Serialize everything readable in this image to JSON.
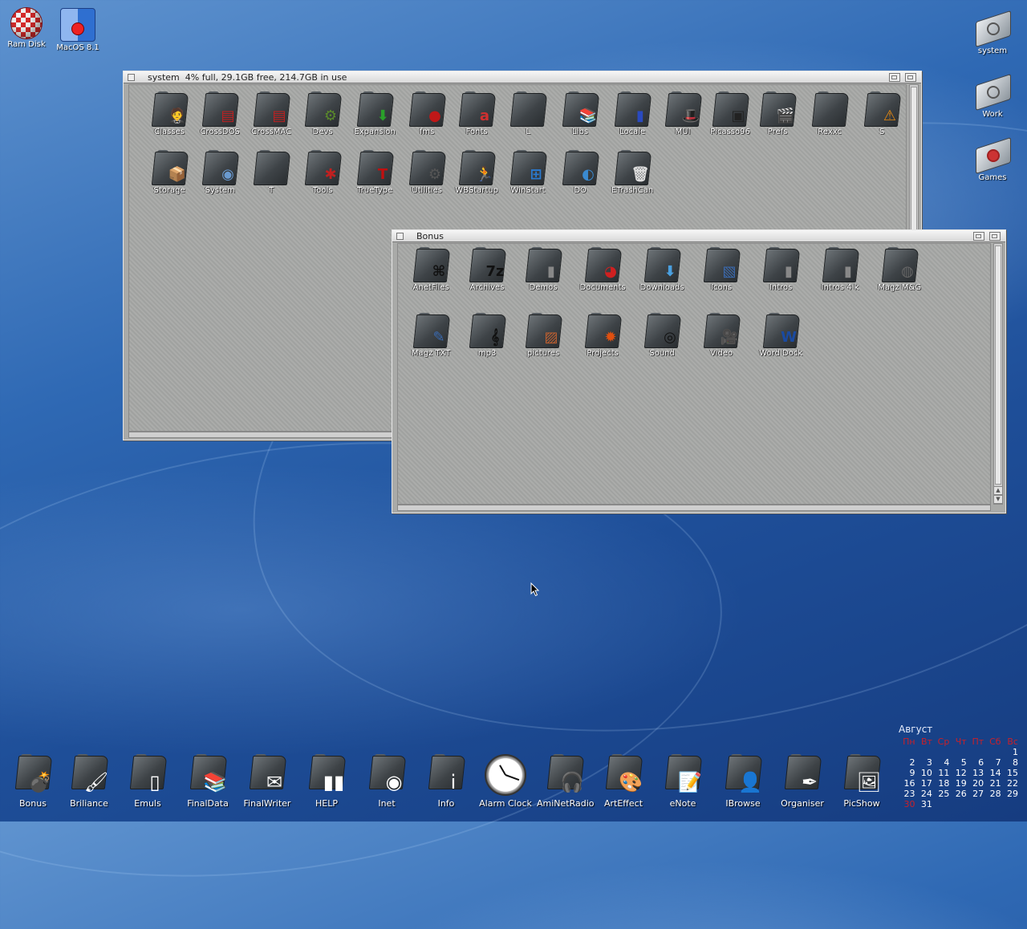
{
  "desktop": {
    "left_icons": [
      {
        "label": "Ram Disk",
        "icon": "boing-ball-icon"
      },
      {
        "label": "MacOS 8.1",
        "icon": "finder-icon"
      }
    ],
    "right_icons": [
      {
        "label": "system",
        "icon": "drive-icon"
      },
      {
        "label": "Work",
        "icon": "drive-icon"
      },
      {
        "label": "Games",
        "icon": "drive-joystick-icon"
      }
    ]
  },
  "system_window": {
    "title": "system  4% full, 29.1GB free, 214.7GB in use",
    "items": [
      {
        "label": "Classes",
        "glyph": "🤵",
        "color": "#222"
      },
      {
        "label": "CrossDOS",
        "glyph": "▤",
        "color": "#c02020"
      },
      {
        "label": "CrossMAC",
        "glyph": "▤",
        "color": "#c02020"
      },
      {
        "label": "Devs",
        "glyph": "⚙",
        "color": "#5a8a2a"
      },
      {
        "label": "Expansion",
        "glyph": "⬇",
        "color": "#2aa02a"
      },
      {
        "label": "fms",
        "glyph": "●",
        "color": "#c01818"
      },
      {
        "label": "Fonts",
        "glyph": "a",
        "color": "#d03030"
      },
      {
        "label": "L",
        "glyph": "",
        "color": "#bbb"
      },
      {
        "label": "Libs",
        "glyph": "📚",
        "color": "#6a4a8a"
      },
      {
        "label": "Locale",
        "glyph": "▮",
        "color": "#2a4ac0"
      },
      {
        "label": "MUI",
        "glyph": "🎩",
        "color": "#222"
      },
      {
        "label": "Picasso96",
        "glyph": "▣",
        "color": "#222"
      },
      {
        "label": "Prefs",
        "glyph": "🎬",
        "color": "#c04020"
      },
      {
        "label": "Rexxc",
        "glyph": "",
        "color": "#bbb"
      },
      {
        "label": "S",
        "glyph": "⚠",
        "color": "#e88a10"
      },
      {
        "label": "Storage",
        "glyph": "📦",
        "color": "#c8a040"
      },
      {
        "label": "System",
        "glyph": "◉",
        "color": "#6a9ad0"
      },
      {
        "label": "T",
        "glyph": "",
        "color": "#888"
      },
      {
        "label": "Tools",
        "glyph": "✱",
        "color": "#c02020"
      },
      {
        "label": "TrueType",
        "glyph": "T",
        "color": "#c01010"
      },
      {
        "label": "Utilities",
        "glyph": "⚙",
        "color": "#555"
      },
      {
        "label": "WBStartup",
        "glyph": "🏃",
        "color": "#111"
      },
      {
        "label": "WinStart",
        "glyph": "⊞",
        "color": "#2a7ad0"
      },
      {
        "label": "DO",
        "glyph": "◐",
        "color": "#3a8ad0"
      },
      {
        "label": "ETrashCan",
        "glyph": "🗑",
        "color": "#ddd"
      }
    ]
  },
  "bonus_window": {
    "title": "Bonus",
    "items": [
      {
        "label": "AnetFiles",
        "glyph": "⌘",
        "color": "#111"
      },
      {
        "label": "Archives",
        "glyph": "7z",
        "color": "#111"
      },
      {
        "label": "Demos",
        "glyph": "▮",
        "color": "#888"
      },
      {
        "label": "Documents",
        "glyph": "◕",
        "color": "#d02020"
      },
      {
        "label": "Downloads",
        "glyph": "⬇",
        "color": "#4aa0e0"
      },
      {
        "label": "Icons",
        "glyph": "▧",
        "color": "#3a6ab0"
      },
      {
        "label": "Intros",
        "glyph": "▮",
        "color": "#888"
      },
      {
        "label": "Intros 4 k",
        "glyph": "▮",
        "color": "#888"
      },
      {
        "label": "Magz M&G",
        "glyph": "◍",
        "color": "#666"
      },
      {
        "label": "Magz TXT",
        "glyph": "✎",
        "color": "#3a6ab0"
      },
      {
        "label": "mp3",
        "glyph": "𝄞",
        "color": "#111"
      },
      {
        "label": "pictures",
        "glyph": "▨",
        "color": "#c06030"
      },
      {
        "label": "Projects",
        "glyph": "✹",
        "color": "#e05010"
      },
      {
        "label": "Sound",
        "glyph": "◎",
        "color": "#111"
      },
      {
        "label": "Video",
        "glyph": "🎥",
        "color": "#444"
      },
      {
        "label": "Word Dock",
        "glyph": "W",
        "color": "#1a4aa0"
      }
    ]
  },
  "dock": [
    {
      "label": "Bonus",
      "glyph": "💣"
    },
    {
      "label": "Briliance",
      "glyph": "🖌"
    },
    {
      "label": "Emuls",
      "glyph": "▯"
    },
    {
      "label": "FinalData",
      "glyph": "📚"
    },
    {
      "label": "FinalWriter",
      "glyph": "✉"
    },
    {
      "label": "HELP",
      "glyph": "▮▮"
    },
    {
      "label": "Inet",
      "glyph": "◉"
    },
    {
      "label": "Info",
      "glyph": "i"
    },
    {
      "label": "Alarm Clock",
      "glyph": "clock"
    },
    {
      "label": "AmiNetRadio",
      "glyph": "🎧"
    },
    {
      "label": "ArtEffect",
      "glyph": "🎨"
    },
    {
      "label": "eNote",
      "glyph": "📝"
    },
    {
      "label": "IBrowse",
      "glyph": "👤"
    },
    {
      "label": "Organiser",
      "glyph": "✒"
    },
    {
      "label": "PicShow",
      "glyph": "🖼"
    }
  ],
  "calendar": {
    "month": "Август",
    "weekdays": [
      "Пн",
      "Вт",
      "Ср",
      "Чт",
      "Пт",
      "Сб",
      "Вс"
    ],
    "weeks": [
      [
        "",
        "",
        "",
        "",
        "",
        "",
        "1"
      ],
      [
        "2",
        "3",
        "4",
        "5",
        "6",
        "7",
        "8"
      ],
      [
        "9",
        "10",
        "11",
        "12",
        "13",
        "14",
        "15"
      ],
      [
        "16",
        "17",
        "18",
        "19",
        "20",
        "21",
        "22"
      ],
      [
        "23",
        "24",
        "25",
        "26",
        "27",
        "28",
        "29"
      ],
      [
        "30",
        "31",
        "",
        "",
        "",
        "",
        ""
      ]
    ],
    "today": "30"
  },
  "colors": {
    "desktop_blue": "#2f69b4",
    "window_gray": "#a9aaa8",
    "calendar_red": "#c8202a"
  }
}
